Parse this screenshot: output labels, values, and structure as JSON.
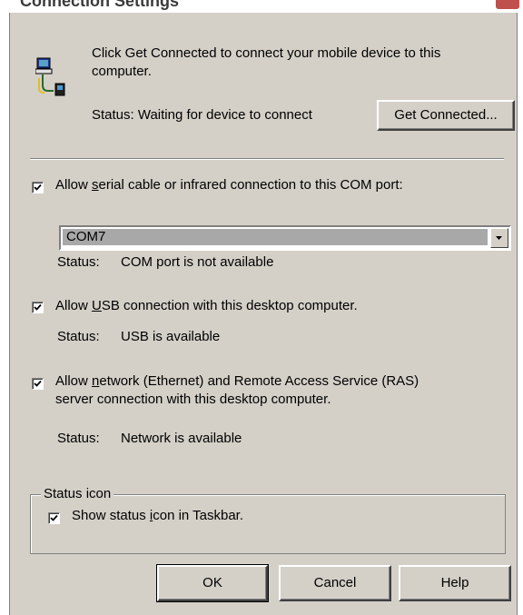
{
  "window": {
    "title": "Connection Settings",
    "close_icon": "close-icon"
  },
  "header": {
    "description": "Click Get Connected to connect your mobile device to this computer.",
    "description_line1": "Click Get Connected to connect your mobile device to this",
    "description_line2": "computer.",
    "status": "Status: Waiting for device to connect",
    "get_connected_label": "Get Connected..."
  },
  "serial": {
    "checked": true,
    "label_prefix": "Allow ",
    "label_mnemonic": "s",
    "label_rest": "erial cable or infrared connection to this COM port:",
    "com_port_value": "COM7",
    "status_label": "Status:",
    "status_value": "COM port is not available"
  },
  "usb": {
    "checked": true,
    "label_prefix": "Allow ",
    "label_mnemonic": "U",
    "label_rest": "SB connection with this desktop computer.",
    "status_label": "Status:",
    "status_value": "USB is available"
  },
  "network": {
    "checked": true,
    "label_prefix": "Allow ",
    "label_mnemonic": "n",
    "label_rest": "etwork (Ethernet) and Remote Access Service (RAS)",
    "label_line2": "server connection with this desktop computer.",
    "status_label": "Status:",
    "status_value": "Network is available"
  },
  "status_icon": {
    "group_label": "Status icon",
    "checked": true,
    "label_prefix": "Show status ",
    "label_mnemonic": "i",
    "label_rest": "con in Taskbar."
  },
  "footer": {
    "ok_label": "OK",
    "cancel_label": "Cancel",
    "help_label": "Help"
  },
  "colors": {
    "dialog_bg": "#d4d0c8",
    "combo_selection": "#a8a8a8",
    "close_button": "#c0504d"
  }
}
